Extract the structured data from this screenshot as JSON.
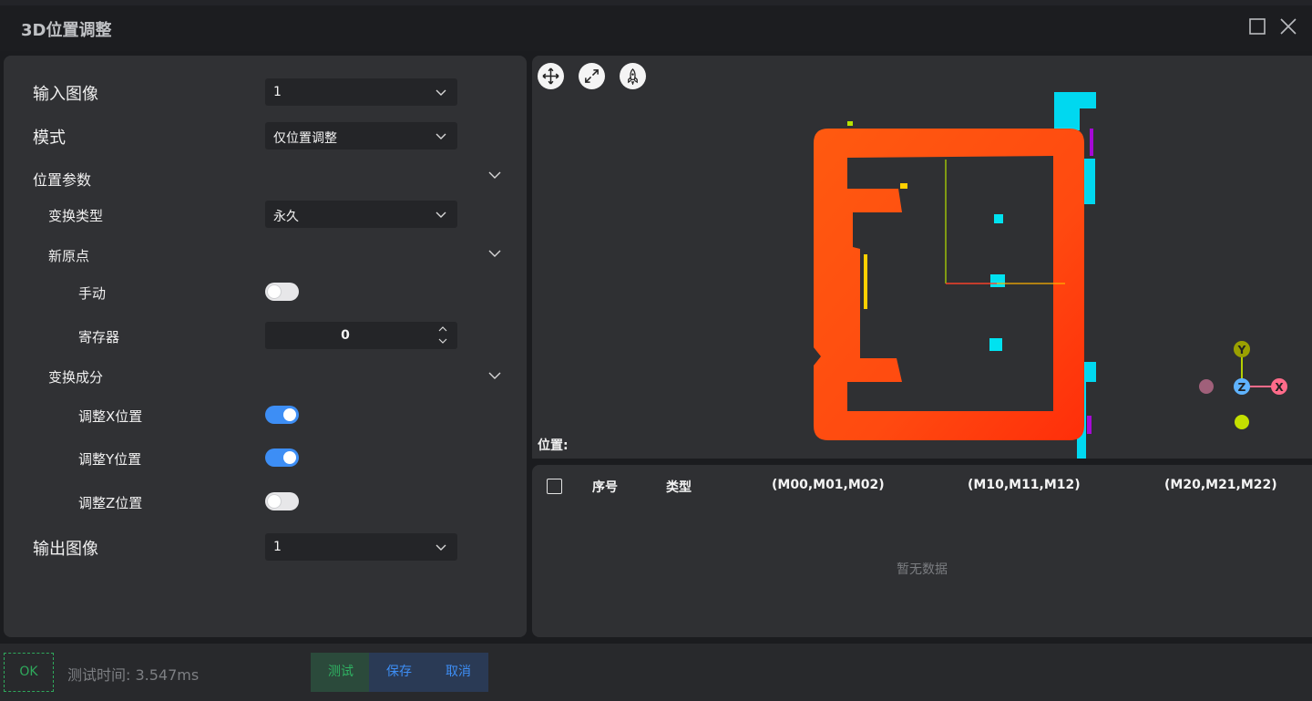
{
  "window": {
    "title": "3D位置调整"
  },
  "params": {
    "input_image_label": "输入图像",
    "input_image_value": "1",
    "mode_label": "模式",
    "mode_value": "仅位置调整",
    "position_params_label": "位置参数",
    "transform_type_label": "变换类型",
    "transform_type_value": "永久",
    "new_origin_label": "新原点",
    "manual_label": "手动",
    "manual_on": false,
    "register_label": "寄存器",
    "register_value": "0",
    "transform_components_label": "变换成分",
    "adjust_x_label": "调整X位置",
    "adjust_x_on": true,
    "adjust_y_label": "调整Y位置",
    "adjust_y_on": true,
    "adjust_z_label": "调整Z位置",
    "adjust_z_on": false,
    "output_image_label": "输出图像",
    "output_image_value": "1"
  },
  "viewer": {
    "position_label": "位置:",
    "axis_labels": {
      "x": "X",
      "y": "Y",
      "z": "Z"
    },
    "colors": {
      "cloud_main": "#ff5a10",
      "cloud_accent": "#00d8f0",
      "axis_x": "#ff6b8a",
      "axis_y": "#b5d000",
      "axis_z": "#5fb3ff"
    }
  },
  "table": {
    "columns": [
      "序号",
      "类型",
      "(M00,M01,M02)",
      "(M10,M11,M12)",
      "(M20,M21,M22)"
    ],
    "rows": [],
    "empty_text": "暂无数据"
  },
  "footer": {
    "status": "OK",
    "test_time": "测试时间: 3.547ms",
    "test_button": "测试",
    "save_button": "保存",
    "cancel_button": "取消"
  }
}
